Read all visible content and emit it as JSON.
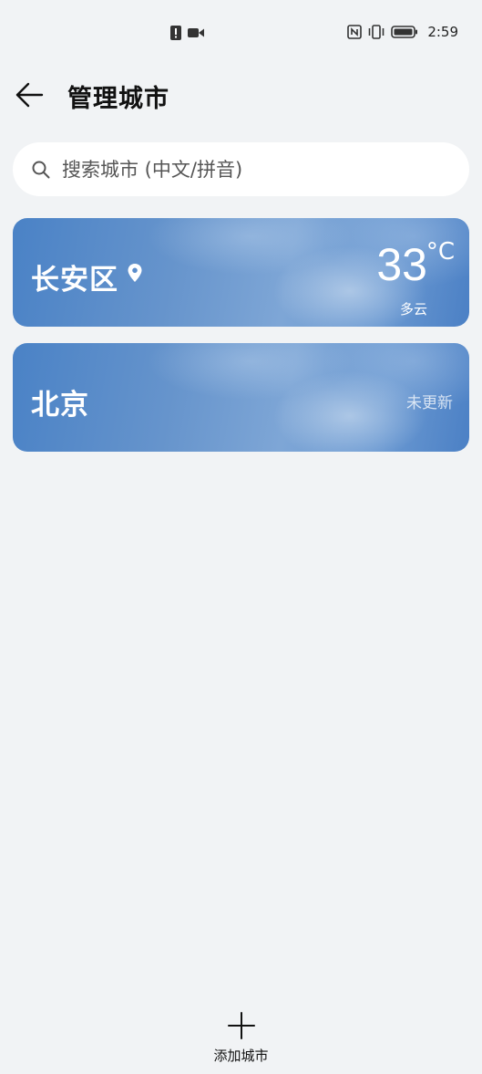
{
  "status_bar": {
    "time": "2:59",
    "icons": [
      "alert-icon",
      "video-icon",
      "nfc-icon",
      "vibrate-icon",
      "battery-icon"
    ]
  },
  "header": {
    "title": "管理城市",
    "back_icon": "arrow-left-icon"
  },
  "search": {
    "placeholder": "搜索城市 (中文/拼音)",
    "icon": "search-icon"
  },
  "cities": [
    {
      "name": "长安区",
      "is_current_location": true,
      "temperature": "33",
      "unit": "°C",
      "condition": "多云"
    },
    {
      "name": "北京",
      "status": "未更新"
    }
  ],
  "footer": {
    "add_label": "添加城市",
    "add_icon": "plus-icon"
  },
  "colors": {
    "background": "#f1f3f5",
    "card_blue": "#4a82c6"
  }
}
